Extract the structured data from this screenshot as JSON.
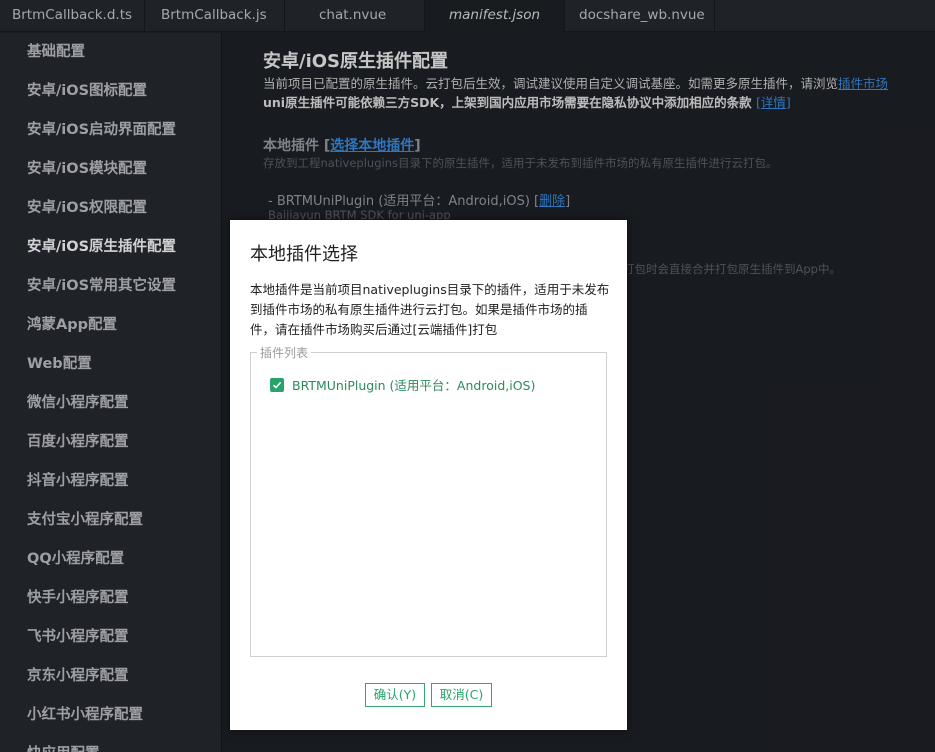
{
  "tabs": [
    {
      "label": "BrtmCallback.d.ts"
    },
    {
      "label": "BrtmCallback.js"
    },
    {
      "label": "chat.nvue"
    },
    {
      "label": "manifest.json",
      "active": true
    },
    {
      "label": "docshare_wb.nvue"
    }
  ],
  "sidebar": {
    "items": [
      {
        "label": "基础配置"
      },
      {
        "label": "安卓/iOS图标配置"
      },
      {
        "label": "安卓/iOS启动界面配置"
      },
      {
        "label": "安卓/iOS模块配置"
      },
      {
        "label": "安卓/iOS权限配置"
      },
      {
        "label": "安卓/iOS原生插件配置",
        "active": true
      },
      {
        "label": "安卓/iOS常用其它设置"
      },
      {
        "label": "鸿蒙App配置"
      },
      {
        "label": "Web配置"
      },
      {
        "label": "微信小程序配置"
      },
      {
        "label": "百度小程序配置"
      },
      {
        "label": "抖音小程序配置"
      },
      {
        "label": "支付宝小程序配置"
      },
      {
        "label": "QQ小程序配置"
      },
      {
        "label": "快手小程序配置"
      },
      {
        "label": "飞书小程序配置"
      },
      {
        "label": "京东小程序配置"
      },
      {
        "label": "小红书小程序配置"
      },
      {
        "label": "快应用配置"
      }
    ]
  },
  "main": {
    "title": "安卓/iOS原生插件配置",
    "desc1": "当前项目已配置的原生插件。云打包后生效，调试建议使用自定义调试基座。如需更多原生插件，请浏览",
    "desc1_link": "插件市场",
    "desc2": "uni原生插件可能依赖三方SDK，上架到国内应用市场需要在隐私协议中添加相应的条款",
    "desc2_link": "[详情]",
    "local_heading": "本地插件 [",
    "local_heading_link": "选择本地插件",
    "local_heading_end": "]",
    "local_desc": "存放到工程nativeplugins目录下的原生插件，适用于未发布到插件市场的私有原生插件进行云打包。",
    "plugin_line": "- BRTMUniPlugin (适用平台：Android,iOS) [",
    "plugin_delete": "删除",
    "plugin_line_end": "]",
    "plugin_sub": "Baijiayun BRTM SDK for uni-app",
    "cloud_tail": "打包时会直接合并打包原生插件到App中。"
  },
  "dialog": {
    "title": "本地插件选择",
    "description": "本地插件是当前项目nativeplugins目录下的插件，适用于未发布到插件市场的私有原生插件进行云打包。如果是插件市场的插件，请在插件市场购买后通过[云端插件]打包",
    "legend": "插件列表",
    "plugins": [
      {
        "label": "BRTMUniPlugin (适用平台：Android,iOS)",
        "checked": true
      }
    ],
    "ok_label": "确认(Y)",
    "cancel_label": "取消(C)"
  },
  "colors": {
    "accent": "#27a36b",
    "link": "#3b8fe8",
    "background": "#1e2127",
    "sidebar": "#262a30"
  }
}
